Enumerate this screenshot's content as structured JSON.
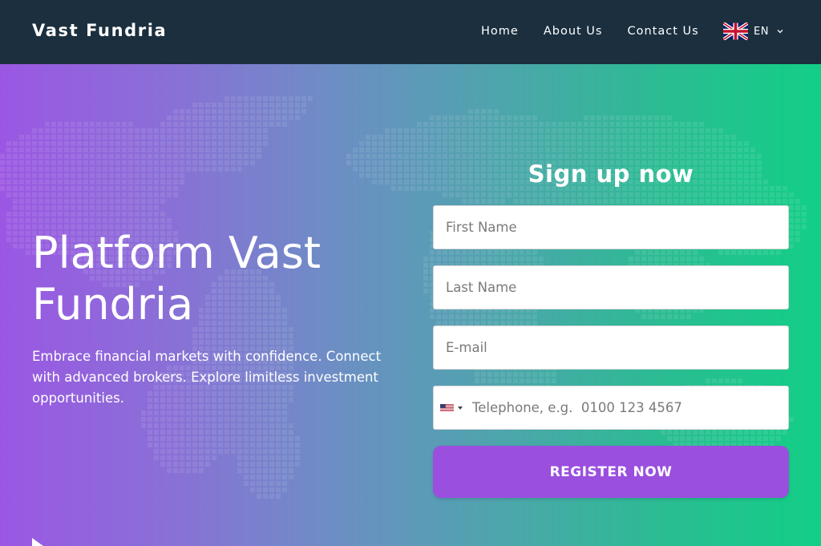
{
  "header": {
    "brand": "Vast Fundria",
    "nav": [
      {
        "label": "Home"
      },
      {
        "label": "About Us"
      },
      {
        "label": "Contact Us"
      }
    ],
    "language": {
      "code": "EN",
      "flag_icon": "uk-flag-icon"
    }
  },
  "hero": {
    "title": "Platform Vast Fundria",
    "subtitle": "Embrace financial markets with confidence. Connect with advanced brokers. Explore limitless investment opportunities."
  },
  "form": {
    "title": "Sign up now",
    "first_name_placeholder": "First Name",
    "last_name_placeholder": "Last Name",
    "email_placeholder": "E-mail",
    "phone_placeholder": "Telephone, e.g.  0100 123 4567",
    "phone_country_icon": "us-flag-icon",
    "submit_label": "REGISTER NOW"
  },
  "colors": {
    "header_bg": "#1b2f3e",
    "gradient_start": "#9b57e3",
    "gradient_end": "#12cf86",
    "button_bg": "#9a4fdf"
  }
}
